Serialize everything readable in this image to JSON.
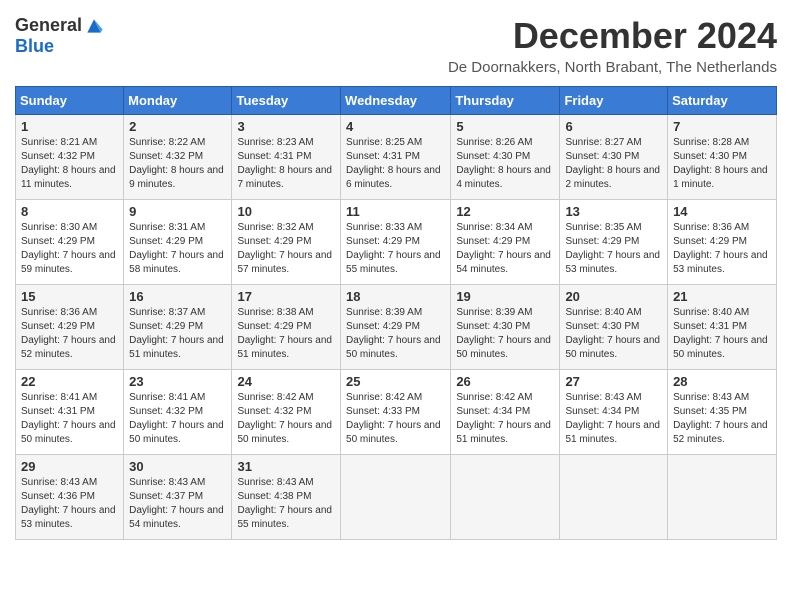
{
  "logo": {
    "general": "General",
    "blue": "Blue"
  },
  "title": "December 2024",
  "location": "De Doornakkers, North Brabant, The Netherlands",
  "days_of_week": [
    "Sunday",
    "Monday",
    "Tuesday",
    "Wednesday",
    "Thursday",
    "Friday",
    "Saturday"
  ],
  "weeks": [
    [
      {
        "day": "1",
        "sunrise": "8:21 AM",
        "sunset": "4:32 PM",
        "daylight": "8 hours and 11 minutes."
      },
      {
        "day": "2",
        "sunrise": "8:22 AM",
        "sunset": "4:32 PM",
        "daylight": "8 hours and 9 minutes."
      },
      {
        "day": "3",
        "sunrise": "8:23 AM",
        "sunset": "4:31 PM",
        "daylight": "8 hours and 7 minutes."
      },
      {
        "day": "4",
        "sunrise": "8:25 AM",
        "sunset": "4:31 PM",
        "daylight": "8 hours and 6 minutes."
      },
      {
        "day": "5",
        "sunrise": "8:26 AM",
        "sunset": "4:30 PM",
        "daylight": "8 hours and 4 minutes."
      },
      {
        "day": "6",
        "sunrise": "8:27 AM",
        "sunset": "4:30 PM",
        "daylight": "8 hours and 2 minutes."
      },
      {
        "day": "7",
        "sunrise": "8:28 AM",
        "sunset": "4:30 PM",
        "daylight": "8 hours and 1 minute."
      }
    ],
    [
      {
        "day": "8",
        "sunrise": "8:30 AM",
        "sunset": "4:29 PM",
        "daylight": "7 hours and 59 minutes."
      },
      {
        "day": "9",
        "sunrise": "8:31 AM",
        "sunset": "4:29 PM",
        "daylight": "7 hours and 58 minutes."
      },
      {
        "day": "10",
        "sunrise": "8:32 AM",
        "sunset": "4:29 PM",
        "daylight": "7 hours and 57 minutes."
      },
      {
        "day": "11",
        "sunrise": "8:33 AM",
        "sunset": "4:29 PM",
        "daylight": "7 hours and 55 minutes."
      },
      {
        "day": "12",
        "sunrise": "8:34 AM",
        "sunset": "4:29 PM",
        "daylight": "7 hours and 54 minutes."
      },
      {
        "day": "13",
        "sunrise": "8:35 AM",
        "sunset": "4:29 PM",
        "daylight": "7 hours and 53 minutes."
      },
      {
        "day": "14",
        "sunrise": "8:36 AM",
        "sunset": "4:29 PM",
        "daylight": "7 hours and 53 minutes."
      }
    ],
    [
      {
        "day": "15",
        "sunrise": "8:36 AM",
        "sunset": "4:29 PM",
        "daylight": "7 hours and 52 minutes."
      },
      {
        "day": "16",
        "sunrise": "8:37 AM",
        "sunset": "4:29 PM",
        "daylight": "7 hours and 51 minutes."
      },
      {
        "day": "17",
        "sunrise": "8:38 AM",
        "sunset": "4:29 PM",
        "daylight": "7 hours and 51 minutes."
      },
      {
        "day": "18",
        "sunrise": "8:39 AM",
        "sunset": "4:29 PM",
        "daylight": "7 hours and 50 minutes."
      },
      {
        "day": "19",
        "sunrise": "8:39 AM",
        "sunset": "4:30 PM",
        "daylight": "7 hours and 50 minutes."
      },
      {
        "day": "20",
        "sunrise": "8:40 AM",
        "sunset": "4:30 PM",
        "daylight": "7 hours and 50 minutes."
      },
      {
        "day": "21",
        "sunrise": "8:40 AM",
        "sunset": "4:31 PM",
        "daylight": "7 hours and 50 minutes."
      }
    ],
    [
      {
        "day": "22",
        "sunrise": "8:41 AM",
        "sunset": "4:31 PM",
        "daylight": "7 hours and 50 minutes."
      },
      {
        "day": "23",
        "sunrise": "8:41 AM",
        "sunset": "4:32 PM",
        "daylight": "7 hours and 50 minutes."
      },
      {
        "day": "24",
        "sunrise": "8:42 AM",
        "sunset": "4:32 PM",
        "daylight": "7 hours and 50 minutes."
      },
      {
        "day": "25",
        "sunrise": "8:42 AM",
        "sunset": "4:33 PM",
        "daylight": "7 hours and 50 minutes."
      },
      {
        "day": "26",
        "sunrise": "8:42 AM",
        "sunset": "4:34 PM",
        "daylight": "7 hours and 51 minutes."
      },
      {
        "day": "27",
        "sunrise": "8:43 AM",
        "sunset": "4:34 PM",
        "daylight": "7 hours and 51 minutes."
      },
      {
        "day": "28",
        "sunrise": "8:43 AM",
        "sunset": "4:35 PM",
        "daylight": "7 hours and 52 minutes."
      }
    ],
    [
      {
        "day": "29",
        "sunrise": "8:43 AM",
        "sunset": "4:36 PM",
        "daylight": "7 hours and 53 minutes."
      },
      {
        "day": "30",
        "sunrise": "8:43 AM",
        "sunset": "4:37 PM",
        "daylight": "7 hours and 54 minutes."
      },
      {
        "day": "31",
        "sunrise": "8:43 AM",
        "sunset": "4:38 PM",
        "daylight": "7 hours and 55 minutes."
      },
      null,
      null,
      null,
      null
    ]
  ]
}
